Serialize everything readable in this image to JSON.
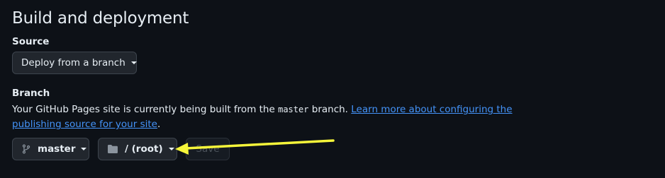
{
  "section": {
    "title": "Build and deployment"
  },
  "source": {
    "label": "Source",
    "selected": "Deploy from a branch"
  },
  "branch": {
    "label": "Branch",
    "description_before": "Your GitHub Pages site is currently being built from the ",
    "branch_code": "master",
    "description_after": " branch. ",
    "learn_more_link": "Learn more about configuring the publishing source for your site",
    "trailing": ".",
    "branch_select": "master",
    "folder_select": "/ (root)",
    "save_label": "Save"
  },
  "annotation": {
    "arrow_color": "#f5f53a"
  },
  "icons": {
    "branch": "git-branch-icon",
    "folder": "folder-icon",
    "caret": "caret-down-icon"
  }
}
